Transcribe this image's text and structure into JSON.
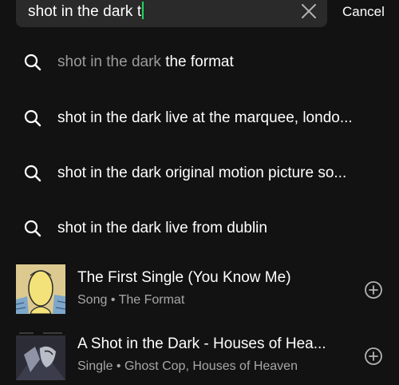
{
  "search": {
    "query": "shot in the dark t",
    "cancel_label": "Cancel"
  },
  "suggestions": [
    {
      "prefix": "shot in the dark ",
      "rest": "the format",
      "icon": "search-icon"
    },
    {
      "prefix": "",
      "rest": "shot in the dark live at the marquee, londo...",
      "icon": "search-icon"
    },
    {
      "prefix": "",
      "rest": "shot in the dark original motion picture so...",
      "icon": "search-icon"
    },
    {
      "prefix": "",
      "rest": "shot in the dark live from dublin",
      "icon": "search-icon"
    }
  ],
  "results": [
    {
      "title": "The First Single (You Know Me)",
      "subtitle": "Song • The Format",
      "icon": "add-circle-icon"
    },
    {
      "title": "A Shot in the Dark - Houses of Hea...",
      "subtitle": "Single • Ghost Cop, Houses of Heaven",
      "icon": "add-circle-icon"
    }
  ],
  "colors": {
    "background": "#121212",
    "search_field": "#2a2a2a",
    "muted_text": "#9b9b9b",
    "secondary_text": "#a7a7a7",
    "caret": "#1ed760"
  }
}
